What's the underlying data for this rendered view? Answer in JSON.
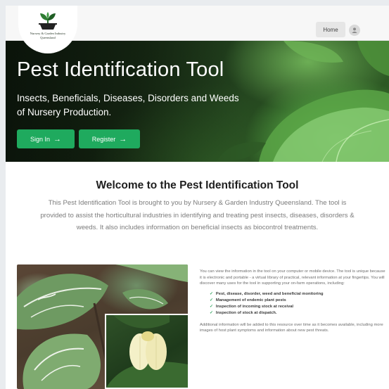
{
  "header": {
    "logo_lines": [
      "Nursery & Garden Industry",
      "Queensland"
    ],
    "nav_home": "Home",
    "user_icon": "user-icon"
  },
  "hero": {
    "title": "Pest Identification Tool",
    "subtitle": "Insects, Beneficials, Diseases, Disorders and Weeds of Nursery Production.",
    "signin_label": "Sign In",
    "register_label": "Register",
    "arrow": "→"
  },
  "welcome": {
    "title": "Welcome to the Pest Identification Tool",
    "body": "This Pest Identification Tool is brought to you by Nursery & Garden Industry Queensland. The tool is provided to assist the horticultural industries in identifying and treating pest insects, diseases, disorders & weeds. It also includes information on beneficial insects as biocontrol treatments."
  },
  "info": {
    "intro": "You can view the information in the tool on your computer or mobile device. The tool is unique because it is electronic and portable - a virtual library of practical, relevant information at your fingertips. You will discover many uses for the tool in supporting your on-farm operations, including:",
    "items": [
      "Pest, disease, disorder, weed and beneficial monitoring",
      "Management of endemic plant pests",
      "Inspection of incoming stock at receival",
      "Inspection of stock at dispatch."
    ],
    "outro": "Additional information will be added to this resource over time as it becomes available, including more images of host plant symptoms and information about new pest threats."
  },
  "colors": {
    "accent_green": "#1faa5e",
    "tick_green": "#2fa35e"
  }
}
